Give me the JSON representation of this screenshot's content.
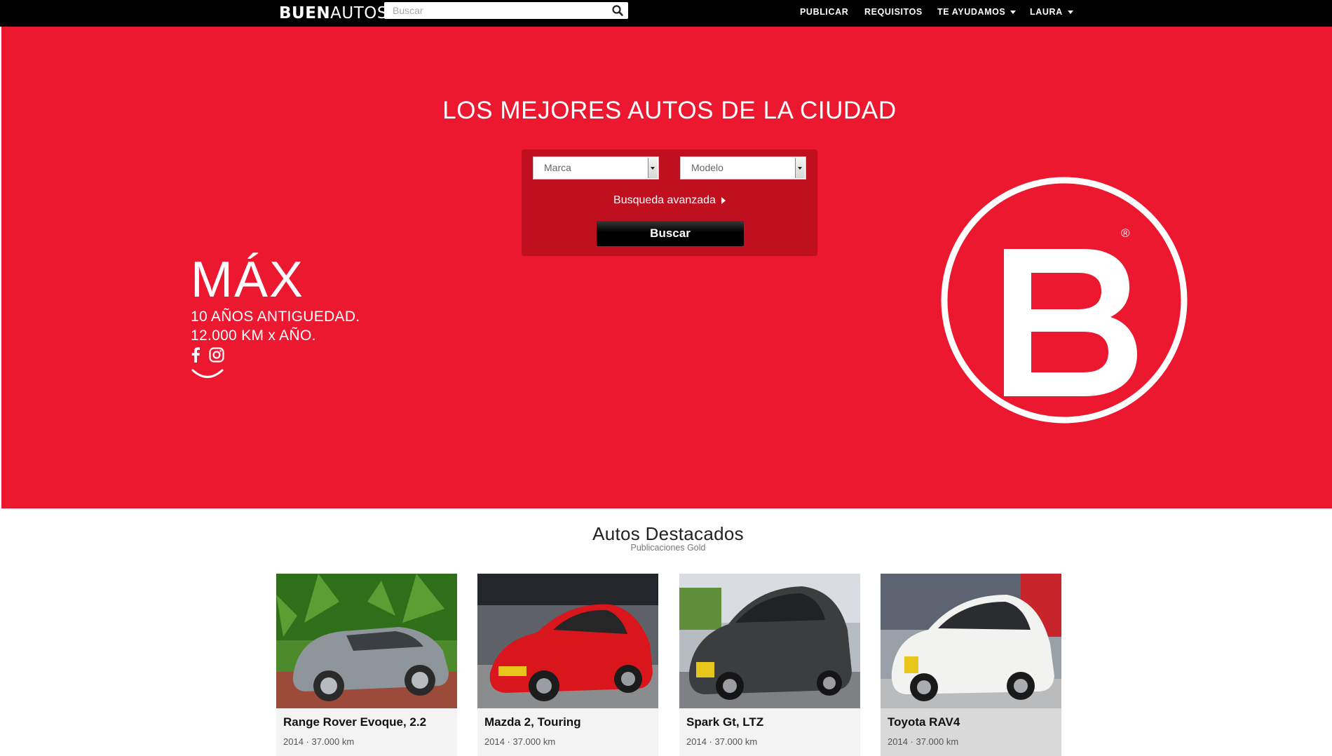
{
  "navbar": {
    "logo_bold": "BUEN",
    "logo_light": "AUTOS",
    "search_placeholder": "Buscar",
    "items": [
      {
        "label": "PUBLICAR",
        "dropdown": false
      },
      {
        "label": "REQUISITOS",
        "dropdown": false
      },
      {
        "label": "TE AYUDAMOS",
        "dropdown": true
      },
      {
        "label": "LAURA",
        "dropdown": true
      }
    ]
  },
  "hero": {
    "title": "LOS MEJORES AUTOS DE LA CIUDAD",
    "background_color": "#ec1830",
    "search": {
      "marca": "Marca",
      "modelo": "Modelo",
      "advanced_label": "Busqueda avanzada",
      "button_label": "Buscar"
    },
    "max": {
      "title": "MÁX",
      "line1": "10 AÑOS ANTIGUEDAD.",
      "line2": "12.000 KM x AÑO."
    },
    "social_icons": [
      "facebook-icon",
      "instagram-icon"
    ],
    "brand_mark": "B",
    "registered": "®"
  },
  "featured": {
    "title": "Autos Destacados",
    "subtitle": "Publicaciones Gold",
    "cars": [
      {
        "name": "Range Rover Evoque, 2.2",
        "meta": "2014 · 37.000 km",
        "color": "#8e969c"
      },
      {
        "name": "Mazda 2, Touring",
        "meta": "2014 · 37.000 km",
        "color": "#d8161c"
      },
      {
        "name": "Spark Gt, LTZ",
        "meta": "2014 · 37.000 km",
        "color": "#3c3d3f"
      },
      {
        "name": "Toyota RAV4",
        "meta": "2014 · 37.000 km",
        "color": "#f2f2f0"
      }
    ]
  }
}
